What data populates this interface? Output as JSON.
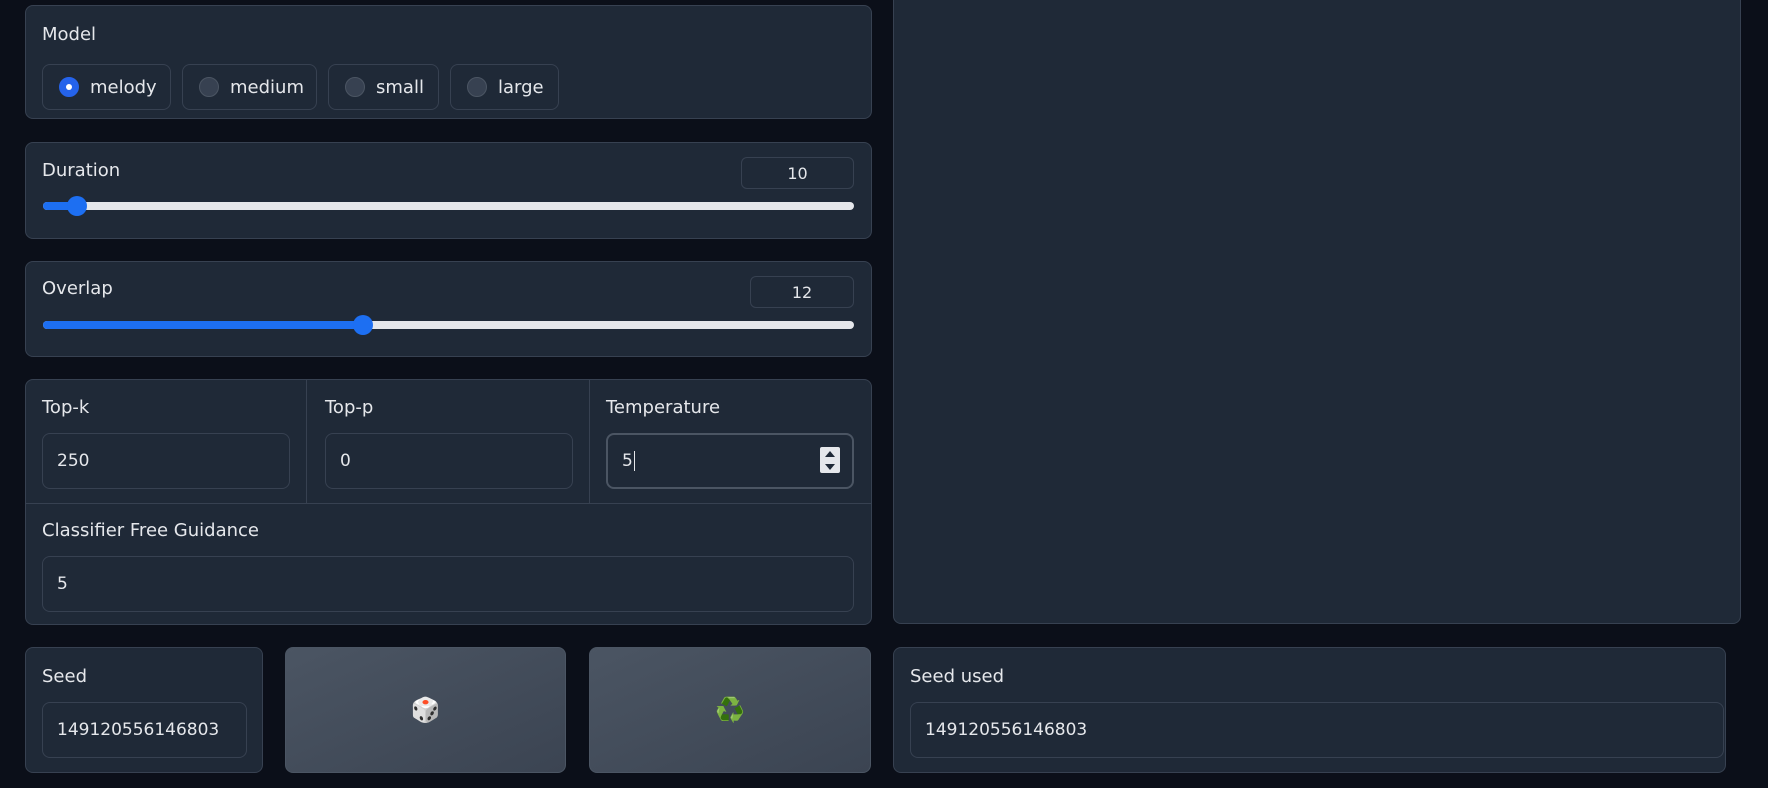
{
  "model": {
    "label": "Model",
    "options": [
      "melody",
      "medium",
      "small",
      "large"
    ],
    "selected": "melody"
  },
  "duration": {
    "label": "Duration",
    "value": "10",
    "fraction": 0.042
  },
  "overlap": {
    "label": "Overlap",
    "value": "12",
    "fraction": 0.394
  },
  "params": {
    "topk": {
      "label": "Top-k",
      "value": "250"
    },
    "topp": {
      "label": "Top-p",
      "value": "0"
    },
    "temperature": {
      "label": "Temperature",
      "value": "5"
    },
    "cfg": {
      "label": "Classifier Free Guidance",
      "value": "5"
    }
  },
  "seed": {
    "label": "Seed",
    "value": "149120556146803"
  },
  "buttons": {
    "random_icon": "🎲",
    "reuse_icon": "♻️"
  },
  "seed_used": {
    "label": "Seed used",
    "value": "149120556146803"
  },
  "colors": {
    "accent": "#1d6ff2",
    "background": "#0b0f19",
    "panel": "#1f2937"
  }
}
